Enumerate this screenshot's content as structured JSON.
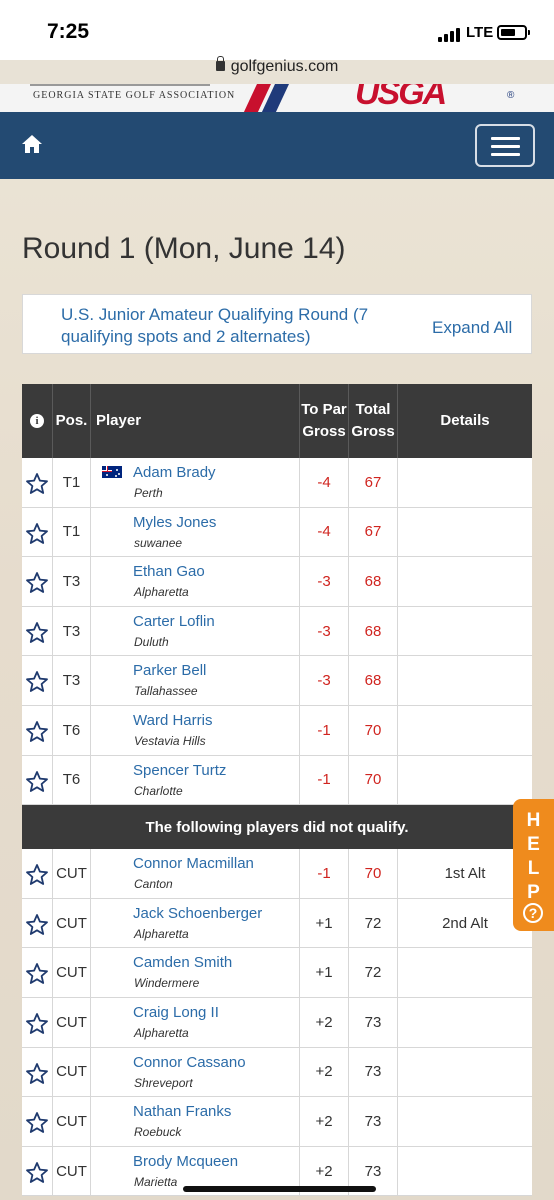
{
  "status_bar": {
    "time": "7:25",
    "network": "LTE"
  },
  "browser": {
    "url": "golfgenius.com"
  },
  "banner": {
    "association": "GEORGIA STATE GOLF ASSOCIATION",
    "logo": "USGA",
    "reg": "®"
  },
  "page": {
    "title": "Round 1 (Mon, June 14)"
  },
  "round": {
    "name": "U.S. Junior Amateur Qualifying Round (7 qualifying spots and 2 alternates)",
    "expand_label": "Expand All"
  },
  "table": {
    "headers": {
      "info": "i",
      "pos": "Pos.",
      "player": "Player",
      "topar": "To Par Gross",
      "total": "Total Gross",
      "details": "Details"
    },
    "qualified": [
      {
        "pos": "T1",
        "name": "Adam Brady",
        "city": "Perth",
        "topar": "-4",
        "total": "67",
        "details": "",
        "flag": "australia"
      },
      {
        "pos": "T1",
        "name": "Myles Jones",
        "city": "suwanee",
        "topar": "-4",
        "total": "67",
        "details": ""
      },
      {
        "pos": "T3",
        "name": "Ethan Gao",
        "city": "Alpharetta",
        "topar": "-3",
        "total": "68",
        "details": ""
      },
      {
        "pos": "T3",
        "name": "Carter Loflin",
        "city": "Duluth",
        "topar": "-3",
        "total": "68",
        "details": ""
      },
      {
        "pos": "T3",
        "name": "Parker Bell",
        "city": "Tallahassee",
        "topar": "-3",
        "total": "68",
        "details": ""
      },
      {
        "pos": "T6",
        "name": "Ward Harris",
        "city": "Vestavia Hills",
        "topar": "-1",
        "total": "70",
        "details": ""
      },
      {
        "pos": "T6",
        "name": "Spencer Turtz",
        "city": "Charlotte",
        "topar": "-1",
        "total": "70",
        "details": ""
      }
    ],
    "divider": "The following players did not qualify.",
    "not_qualified": [
      {
        "pos": "CUT",
        "name": "Connor Macmillan",
        "city": "Canton",
        "topar": "-1",
        "total": "70",
        "details": "1st Alt"
      },
      {
        "pos": "CUT",
        "name": "Jack Schoenberger",
        "city": "Alpharetta",
        "topar": "+1",
        "total": "72",
        "details": "2nd Alt"
      },
      {
        "pos": "CUT",
        "name": "Camden Smith",
        "city": "Windermere",
        "topar": "+1",
        "total": "72",
        "details": ""
      },
      {
        "pos": "CUT",
        "name": "Craig Long II",
        "city": "Alpharetta",
        "topar": "+2",
        "total": "73",
        "details": ""
      },
      {
        "pos": "CUT",
        "name": "Connor Cassano",
        "city": "Shreveport",
        "topar": "+2",
        "total": "73",
        "details": ""
      },
      {
        "pos": "CUT",
        "name": "Nathan Franks",
        "city": "Roebuck",
        "topar": "+2",
        "total": "73",
        "details": ""
      },
      {
        "pos": "CUT",
        "name": "Brody Mcqueen",
        "city": "Marietta",
        "topar": "+2",
        "total": "73",
        "details": ""
      }
    ]
  },
  "help": {
    "label": "HELP",
    "icon": "question-icon",
    "question_mark": "?"
  },
  "colors": {
    "nav": "#234a72",
    "link": "#2c6ca8",
    "under_par": "#d0241f",
    "help": "#ef8b1d"
  }
}
